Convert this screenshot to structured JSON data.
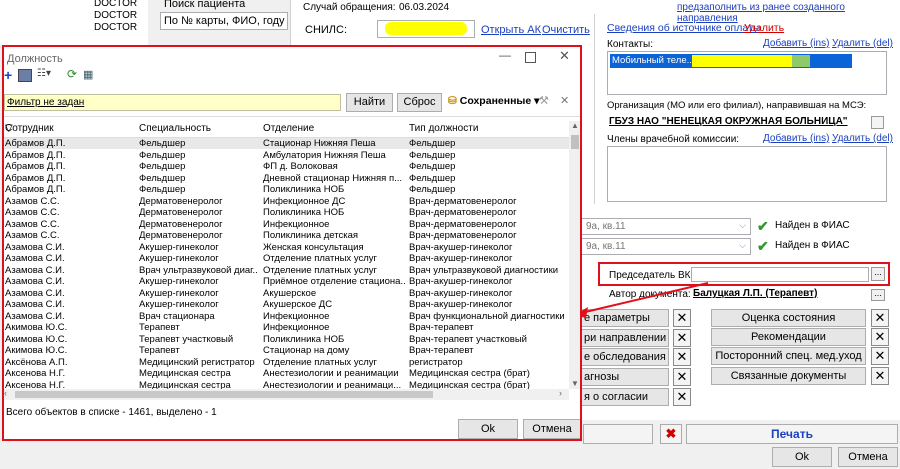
{
  "bg_left": {
    "doctor_items": [
      "DOCTOR",
      "DOCTOR",
      "DOCTOR"
    ]
  },
  "patient_search": {
    "label": "Поиск пациента",
    "placeholder": "По № карты, ФИО, году р"
  },
  "case": {
    "label": "Случай обращения:",
    "date": "06.03.2024",
    "fill_link": "предзаполнить из ранее созданного направления"
  },
  "snils": {
    "label": "СНИЛС:",
    "open_ak": "Открыть АК",
    "clear": "Очистить"
  },
  "payment": {
    "source_link": "Сведения об источнике оплаты",
    "delete": "Удалить"
  },
  "contacts": {
    "label": "Контакты:",
    "add": "Добавить (ins)",
    "remove": "Удалить (del)",
    "item": "Мобильный теле..."
  },
  "organization": {
    "label": "Организация (МО или его филиал), направившая на МСЭ:",
    "value": "ГБУЗ НАО \"НЕНЕЦКАЯ ОКРУЖНАЯ БОЛЬНИЦА\""
  },
  "commission": {
    "label": "Члены врачебной комиссии:",
    "add": "Добавить (ins)",
    "remove": "Удалить (del)"
  },
  "address": {
    "value1": "9а, кв.11",
    "value2": "9а, кв.11",
    "fias": "Найден в ФИАС"
  },
  "chairman": {
    "label": "Председатель ВК:",
    "ellipsis": "..."
  },
  "author": {
    "label": "Автор документа:",
    "value": "Балуцкая Л.П. (Терапевт)"
  },
  "left_buttons": [
    "е параметры",
    "ри направлении",
    "е обследования",
    "агнозы",
    "я о согласии"
  ],
  "right_buttons": [
    "Оценка состояния",
    "Рекомендации",
    "Посторонний спец. мед.уход",
    "Связанные документы"
  ],
  "bottom": {
    "print": "Печать",
    "ok": "Ok",
    "cancel": "Отмена"
  },
  "dialog": {
    "title": "Должность",
    "filter": "Фильтр не задан",
    "find": "Найти",
    "reset": "Сброс",
    "saved": "Сохраненные",
    "columns": [
      "Сотрудник",
      "Специальность",
      "Отделение",
      "Тип должности"
    ],
    "rows": [
      [
        "Абрамов Д.П.",
        "Фельдшер",
        "Стационар Нижняя Пеша",
        "Фельдшер"
      ],
      [
        "Абрамов Д.П.",
        "Фельдшер",
        "Амбулатория Нижняя Пеша",
        "Фельдшер"
      ],
      [
        "Абрамов Д.П.",
        "Фельдшер",
        "ФП д. Волоковая",
        "Фельдшер"
      ],
      [
        "Абрамов Д.П.",
        "Фельдшер",
        "Дневной стационар Нижняя п...",
        "Фельдшер"
      ],
      [
        "Абрамов Д.П.",
        "Фельдшер",
        "Поликлиника НОБ",
        "Фельдшер"
      ],
      [
        "Азамов С.С.",
        "Дерматовенеролог",
        "Инфекционное ДС",
        "Врач-дерматовенеролог"
      ],
      [
        "Азамов С.С.",
        "Дерматовенеролог",
        "Поликлиника НОБ",
        "Врач-дерматовенеролог"
      ],
      [
        "Азамов С.С.",
        "Дерматовенеролог",
        "Инфекционное",
        "Врач-дерматовенеролог"
      ],
      [
        "Азамов С.С.",
        "Дерматовенеролог",
        "Поликлиника детская",
        "Врач-дерматовенеролог"
      ],
      [
        "Азамова С.И.",
        "Акушер-гинеколог",
        "Женская консультация",
        "Врач-акушер-гинеколог"
      ],
      [
        "Азамова С.И.",
        "Акушер-гинеколог",
        "Отделение платных услуг",
        "Врач-акушер-гинеколог"
      ],
      [
        "Азамова С.И.",
        "Врач ультразвуковой диаг...",
        "Отделение платных услуг",
        "Врач ультразвуковой диагностики"
      ],
      [
        "Азамова С.И.",
        "Акушер-гинеколог",
        "Приёмное отделение стациона...",
        "Врач-акушер-гинеколог"
      ],
      [
        "Азамова С.И.",
        "Акушер-гинеколог",
        "Акушерское",
        "Врач-акушер-гинеколог"
      ],
      [
        "Азамова С.И.",
        "Акушер-гинеколог",
        "Акушерское ДС",
        "Врач-акушер-гинеколог"
      ],
      [
        "Азамова С.И.",
        "Врач стационара",
        "Инфекционное",
        "Врач функциональной диагностики"
      ],
      [
        "Акимова Ю.С.",
        "Терапевт",
        "Инфекционное",
        "Врач-терапевт"
      ],
      [
        "Акимова Ю.С.",
        "Терапевт участковый",
        "Поликлиника НОБ",
        "Врач-терапевт участковый"
      ],
      [
        "Акимова Ю.С.",
        "Терапевт",
        "Стационар на дому",
        "Врач-терапевт"
      ],
      [
        "Аксёнова А.П.",
        "Медицинский регистратор",
        "Отделение платных услуг",
        "регистратор"
      ],
      [
        "Аксенова Н.Г.",
        "Медицинская сестра",
        "Анестезиологии и реанимации",
        "Медицинская сестра (брат)"
      ],
      [
        "Аксенова Н.Г.",
        "Медицинская сестра",
        "Анестезиологии и реанимаци...",
        "Медицинская сестра (брат)"
      ]
    ],
    "status": "Всего объектов в списке - 1461, выделено - 1",
    "ok": "Ok",
    "cancel": "Отмена"
  },
  "colors": {
    "highlight": "#ffff00",
    "annotation": "#e0101a",
    "link": "#1a3fbf"
  }
}
